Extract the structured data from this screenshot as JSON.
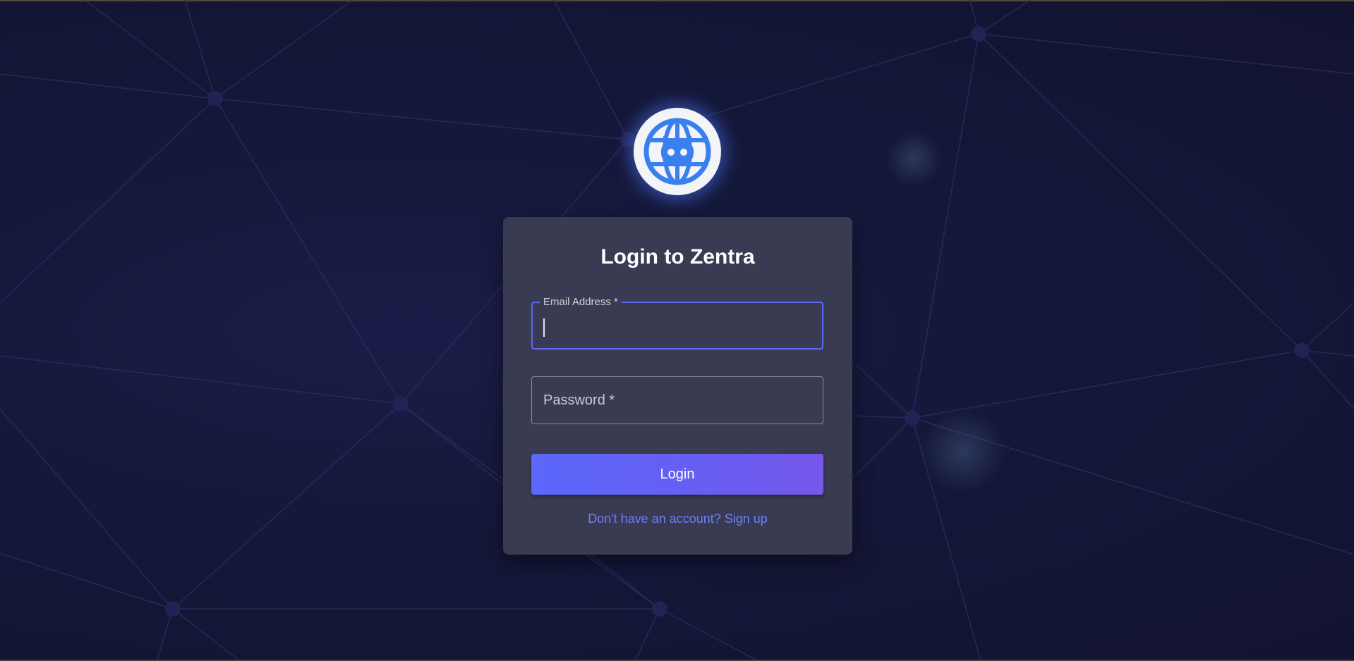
{
  "app": {
    "name": "Zentra",
    "logo_icon": "globe-robot-icon"
  },
  "login": {
    "title": "Login to Zentra",
    "email_label": "Email Address *",
    "email_value": "",
    "password_label": "Password *",
    "password_value": "",
    "submit_label": "Login",
    "signup_link": "Don't have an account? Sign up"
  },
  "colors": {
    "background": "#14173a",
    "card": "#393b52",
    "accent": "#5b68fb",
    "link": "#6f7df5",
    "logo_blue": "#3a7ff0"
  }
}
